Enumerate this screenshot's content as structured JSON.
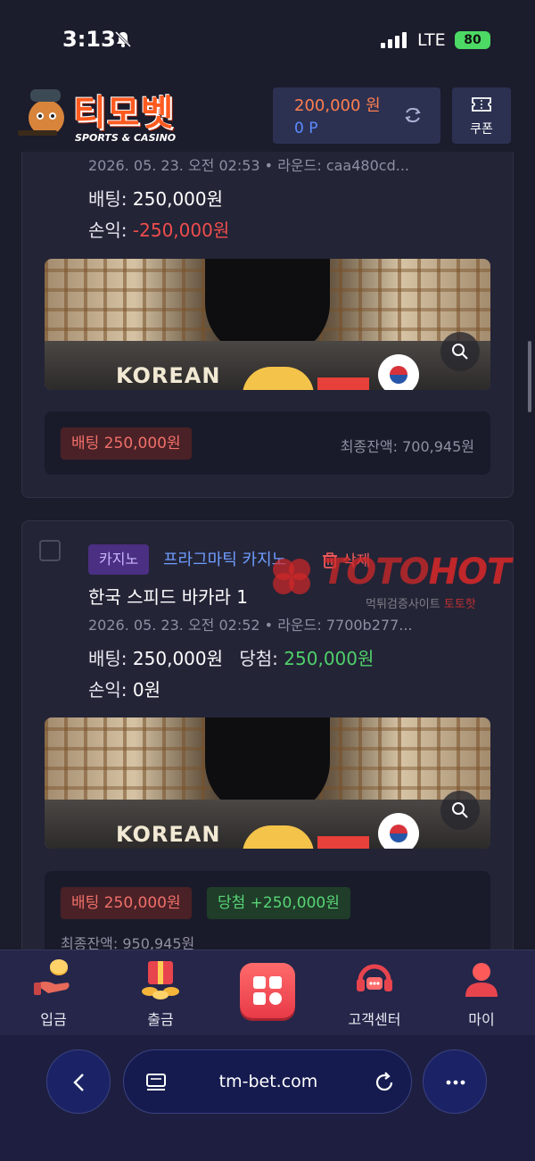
{
  "status": {
    "time": "3:13",
    "network": "LTE",
    "battery": "80"
  },
  "header": {
    "logo_text": "티모벳",
    "logo_sub": "SPORTS & CASINO",
    "balance": "200,000 원",
    "points": "0 P",
    "coupon_label": "쿠폰"
  },
  "bets": [
    {
      "meta": "2026. 05. 23. 오전 02:53 • 라운드: caa480cd...",
      "bet_label": "배팅:",
      "bet_amount": "250,000원",
      "profit_label": "손익:",
      "profit": "-250,000원",
      "game_image_text": "KOREAN",
      "pill_bet": "배팅 250,000원",
      "final_balance": "최종잔액: 700,945원"
    },
    {
      "category": "카지노",
      "provider": "프라그마틱 카지노",
      "delete_label": "삭제",
      "title": "한국 스피드 바카라 1",
      "meta": "2026. 05. 23. 오전 02:52 • 라운드: 7700b277...",
      "bet_label": "배팅:",
      "bet_amount": "250,000원",
      "win_label": "당첨:",
      "win_amount": "250,000원",
      "profit_label": "손익:",
      "profit": "0원",
      "game_image_text": "KOREAN",
      "pill_bet": "배팅 250,000원",
      "pill_win": "당첨 +250,000원",
      "final_balance": "최종잔액: 950,945원"
    }
  ],
  "watermark": {
    "brand_a": "TOTO",
    "brand_b": "HOT",
    "sub": "먹튀검증사이트",
    "sub_red": "토토핫"
  },
  "bottom_nav": [
    {
      "label": "입금",
      "icon": "deposit-coins-icon"
    },
    {
      "label": "출금",
      "icon": "withdraw-gift-icon"
    },
    {
      "label": "",
      "icon": "menu-grid-icon"
    },
    {
      "label": "고객센터",
      "icon": "headset-support-icon"
    },
    {
      "label": "마이",
      "icon": "user-profile-icon"
    }
  ],
  "browser": {
    "url": "tm-bet.com"
  },
  "colors": {
    "accent_orange": "#ff7e4f",
    "loss_red": "#f04d4d",
    "win_green": "#4fd06a",
    "link_blue": "#6f9cff"
  }
}
